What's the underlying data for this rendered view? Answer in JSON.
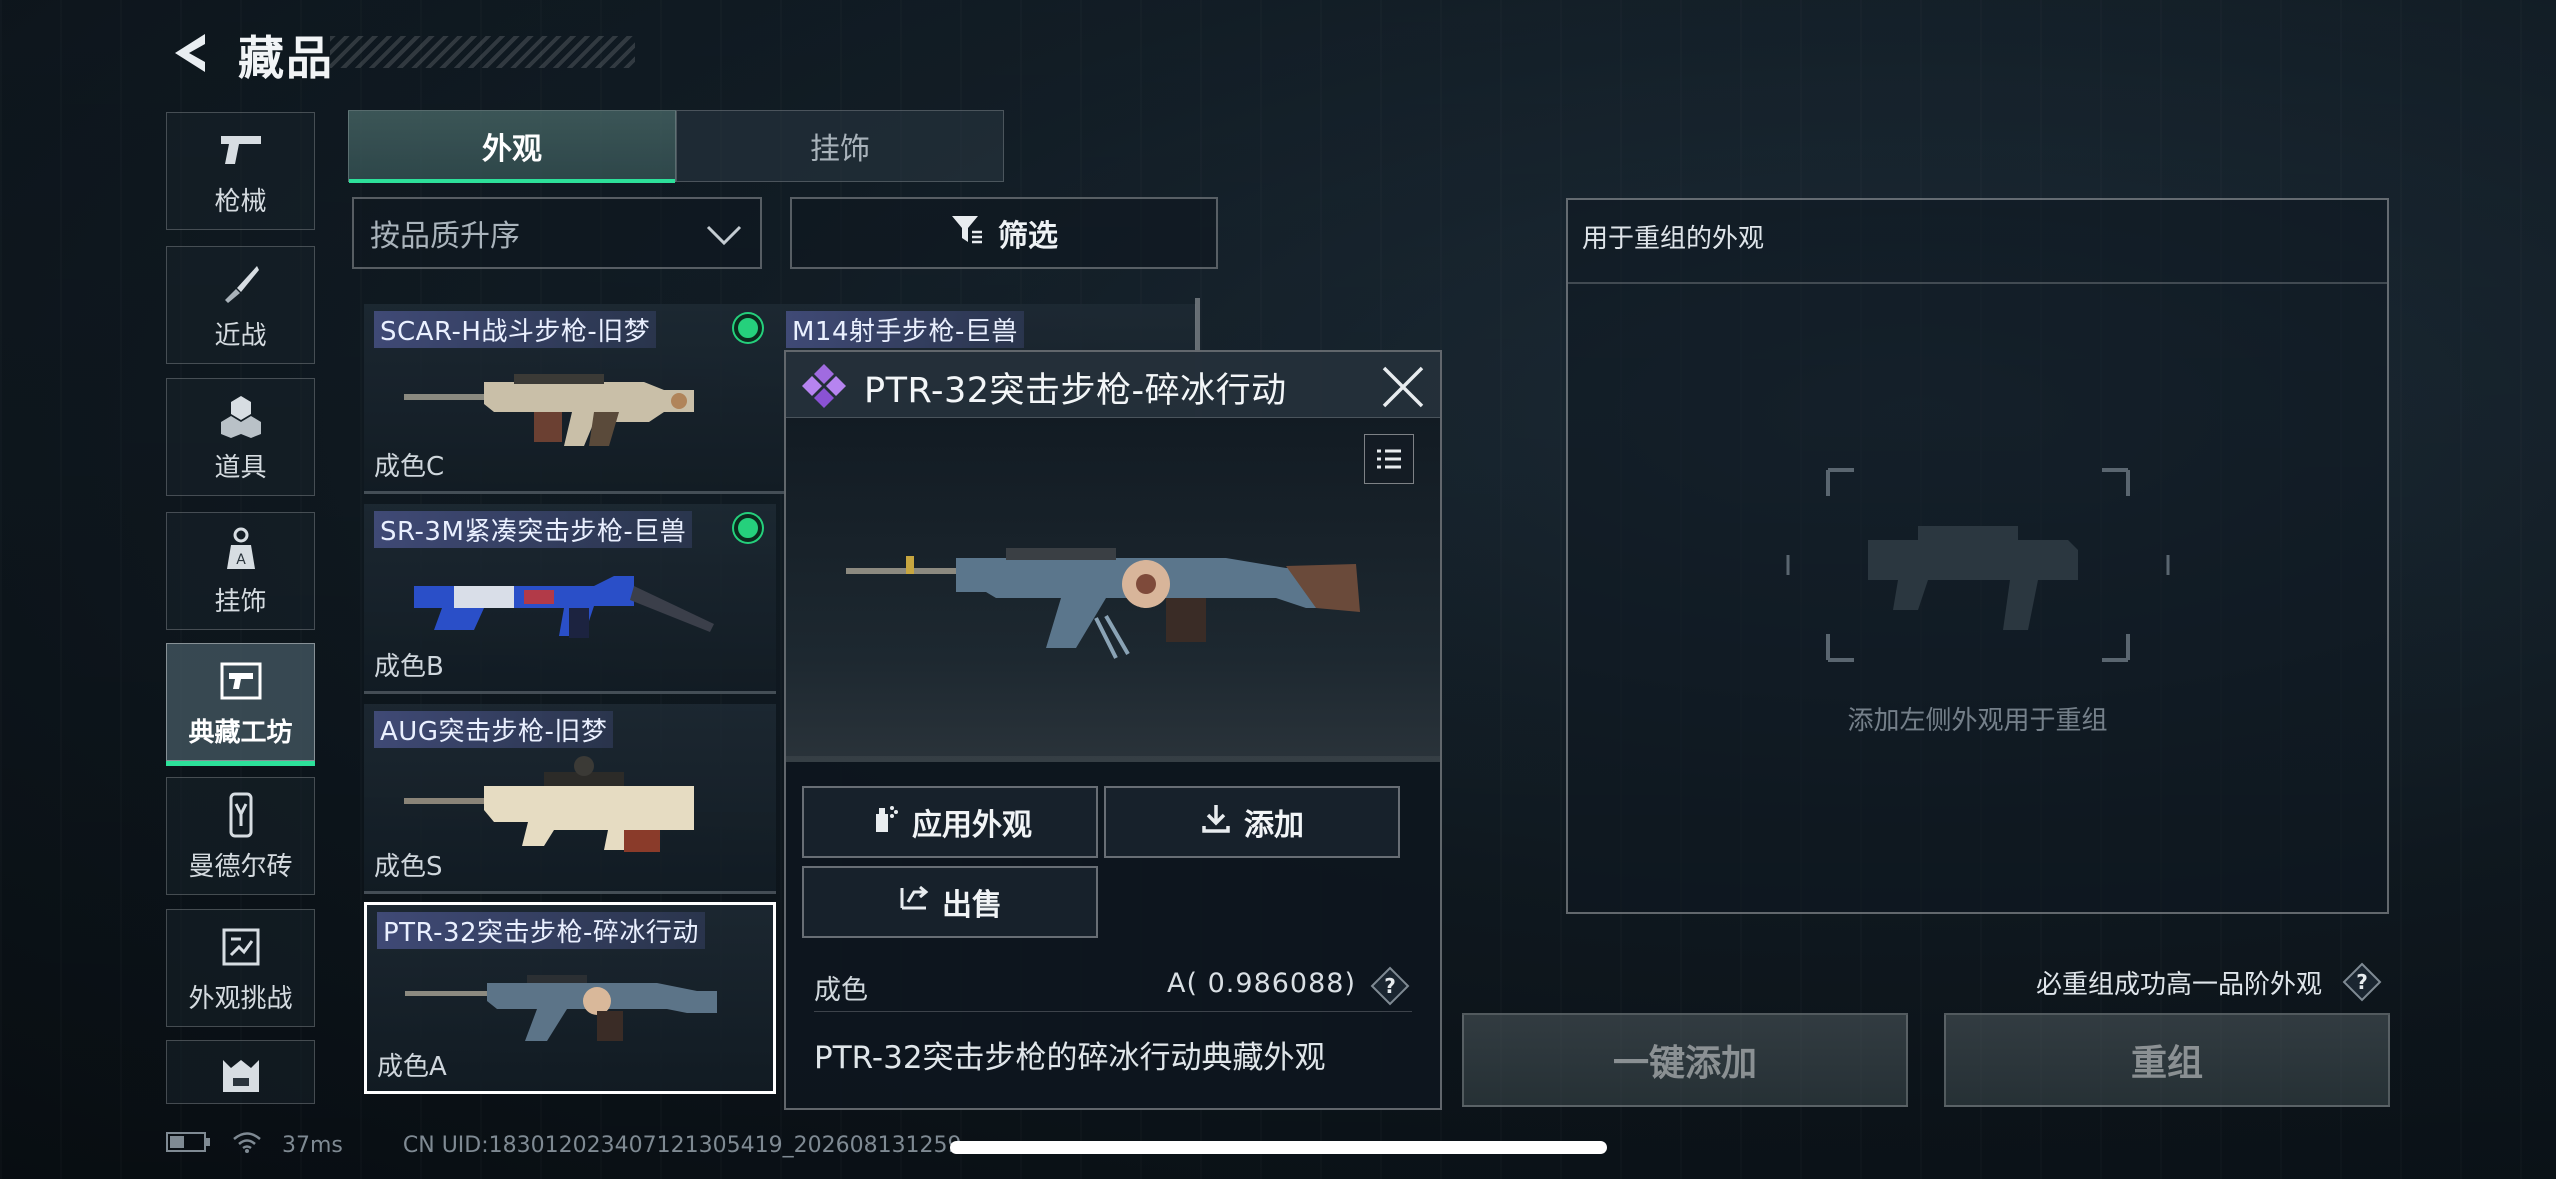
{
  "header": {
    "title": "藏品"
  },
  "sidebar": {
    "items": [
      {
        "label": "枪械",
        "icon": "pistol-icon"
      },
      {
        "label": "近战",
        "icon": "knife-icon"
      },
      {
        "label": "道具",
        "icon": "grenade-icon"
      },
      {
        "label": "挂饰",
        "icon": "charm-icon"
      },
      {
        "label": "典藏工坊",
        "icon": "workshop-icon",
        "active": true
      },
      {
        "label": "曼德尔砖",
        "icon": "mandel-brick-icon"
      },
      {
        "label": "外观挑战",
        "icon": "challenge-icon"
      },
      {
        "label": "",
        "icon": "more-icon"
      }
    ]
  },
  "tabs": [
    {
      "label": "外观",
      "active": true
    },
    {
      "label": "挂饰",
      "active": false
    }
  ],
  "sort": {
    "value": "按品质升序"
  },
  "filter": {
    "label": "筛选"
  },
  "items": [
    {
      "name": "SCAR-H战斗步枪-旧梦",
      "grade": "成色C",
      "equipped": true
    },
    {
      "name": "M14射手步枪-巨兽",
      "grade": "",
      "equipped": false
    },
    {
      "name": "SR-3M紧凑突击步枪-巨兽",
      "grade": "成色B",
      "equipped": true
    },
    {
      "name": "AUG突击步枪-旧梦",
      "grade": "成色S",
      "equipped": false
    },
    {
      "name": "PTR-32突击步枪-碎冰行动",
      "grade": "成色A",
      "equipped": false,
      "selected": true
    }
  ],
  "detail": {
    "title": "PTR-32突击步枪-碎冰行动",
    "buttons": {
      "apply": "应用外观",
      "add": "添加",
      "sell": "出售"
    },
    "grade_label": "成色",
    "grade_value": "A( 0.986088)",
    "help": "?",
    "description": "PTR-32突击步枪的碎冰行动典藏外观"
  },
  "reforge": {
    "header": "用于重组的外观",
    "hint": "添加左侧外观用于重组",
    "guarantee": "必重组成功高一品阶外观",
    "help": "?",
    "one_click_add": "一键添加",
    "reforge_button": "重组"
  },
  "status": {
    "ping": "37ms",
    "uid": "CN UID:18301202340712130541​9_202608131259"
  },
  "colors": {
    "accent": "#2de09a",
    "equipped": "#25d07c",
    "gem": "#a06be0"
  }
}
